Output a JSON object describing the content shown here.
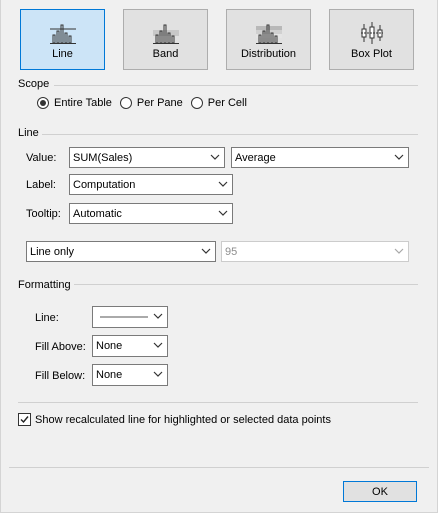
{
  "tabs": [
    {
      "label": "Line",
      "icon": "line-icon",
      "selected": true
    },
    {
      "label": "Band",
      "icon": "band-icon",
      "selected": false
    },
    {
      "label": "Distribution",
      "icon": "distribution-icon",
      "selected": false
    },
    {
      "label": "Box Plot",
      "icon": "box-plot-icon",
      "selected": false
    }
  ],
  "scope": {
    "heading": "Scope",
    "options": [
      {
        "label": "Entire Table",
        "checked": true
      },
      {
        "label": "Per Pane",
        "checked": false
      },
      {
        "label": "Per Cell",
        "checked": false
      }
    ]
  },
  "line": {
    "heading": "Line",
    "value_label": "Value:",
    "value_field": "SUM(Sales)",
    "value_agg": "Average",
    "label_label": "Label:",
    "label_value": "Computation",
    "tooltip_label": "Tooltip:",
    "tooltip_value": "Automatic",
    "line_mode": "Line only",
    "confidence": "95"
  },
  "formatting": {
    "heading": "Formatting",
    "line_label": "Line:",
    "fill_above_label": "Fill Above:",
    "fill_above_value": "None",
    "fill_below_label": "Fill Below:",
    "fill_below_value": "None"
  },
  "recalc": {
    "label": "Show recalculated line for highlighted or selected data points",
    "checked": true
  },
  "ok_label": "OK",
  "colors": {
    "selected_tile_bg": "#cce4f7",
    "selected_tile_border": "#0078d7",
    "tile_bg": "#e1e1e1",
    "window_bg": "#f0f0f0"
  }
}
